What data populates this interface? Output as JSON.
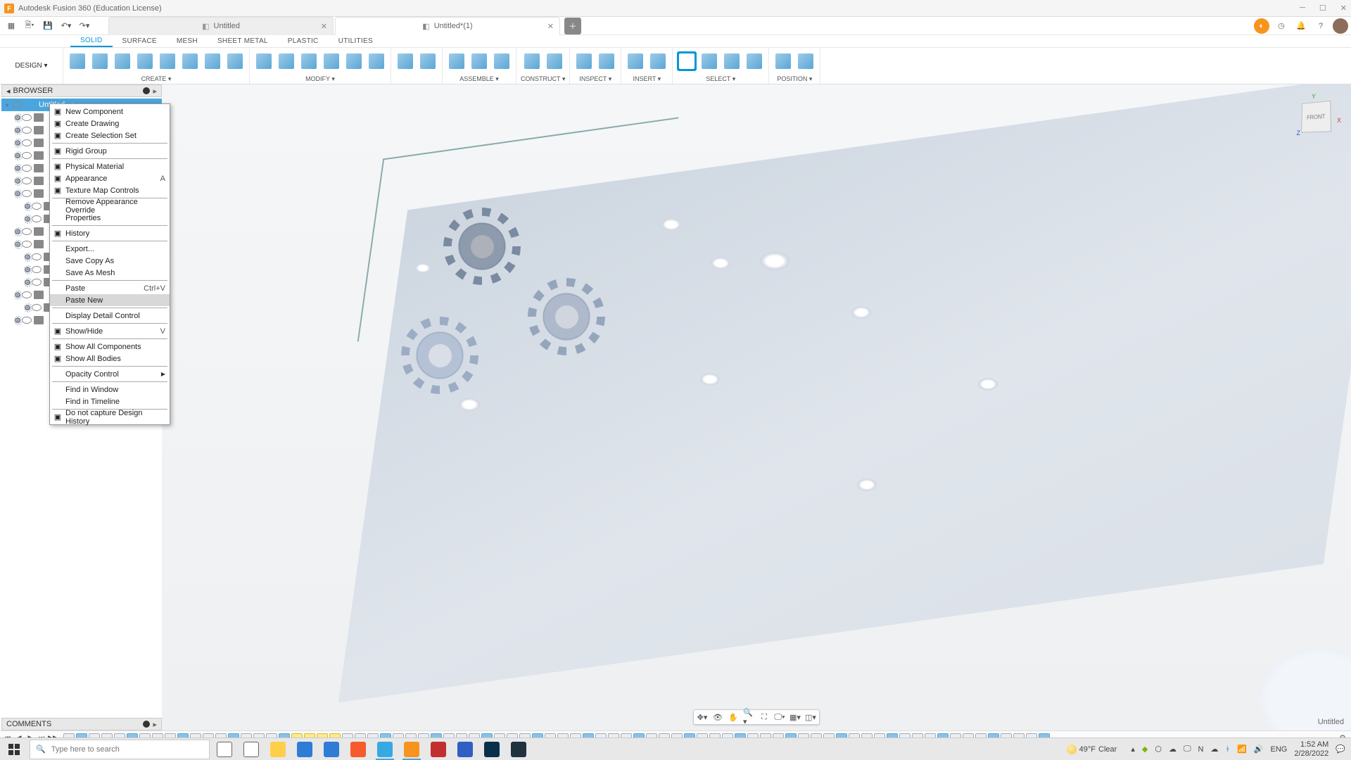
{
  "titlebar": {
    "app_badge": "F",
    "title": "Autodesk Fusion 360 (Education License)"
  },
  "tabs": [
    {
      "label": "Untitled",
      "active": false
    },
    {
      "label": "Untitled*(1)",
      "active": true
    }
  ],
  "ribbon": {
    "design_label": "DESIGN ▾",
    "tabs": [
      "SOLID",
      "SURFACE",
      "MESH",
      "SHEET METAL",
      "PLASTIC",
      "UTILITIES"
    ],
    "active_tab": "SOLID",
    "groups": [
      {
        "label": "CREATE ▾",
        "icons": 8
      },
      {
        "label": "MODIFY ▾",
        "icons": 6
      },
      {
        "label": "",
        "icons": 2
      },
      {
        "label": "ASSEMBLE ▾",
        "icons": 3
      },
      {
        "label": "CONSTRUCT ▾",
        "icons": 2
      },
      {
        "label": "INSPECT ▾",
        "icons": 2
      },
      {
        "label": "INSERT ▾",
        "icons": 2
      },
      {
        "label": "SELECT ▾",
        "icons": 4
      },
      {
        "label": "POSITION ▾",
        "icons": 2
      }
    ]
  },
  "browser": {
    "header": "BROWSER",
    "root": "Untitled",
    "rows": 18
  },
  "context_menu": {
    "items": [
      {
        "label": "New Component",
        "icon": "component-icon"
      },
      {
        "label": "Create Drawing",
        "icon": "drawing-icon"
      },
      {
        "label": "Create Selection Set",
        "icon": "selection-set-icon"
      },
      {
        "sep": true
      },
      {
        "label": "Rigid Group",
        "icon": "rigid-group-icon"
      },
      {
        "sep": true
      },
      {
        "label": "Physical Material",
        "icon": "material-icon"
      },
      {
        "label": "Appearance",
        "icon": "appearance-icon",
        "shortcut": "A"
      },
      {
        "label": "Texture Map Controls",
        "icon": "texture-icon"
      },
      {
        "sep": true
      },
      {
        "label": "Remove Appearance Override"
      },
      {
        "label": "Properties"
      },
      {
        "sep": true
      },
      {
        "label": "History",
        "icon": "history-icon"
      },
      {
        "sep": true
      },
      {
        "label": "Export..."
      },
      {
        "label": "Save Copy As"
      },
      {
        "label": "Save As Mesh"
      },
      {
        "sep": true
      },
      {
        "label": "Paste",
        "shortcut": "Ctrl+V"
      },
      {
        "label": "Paste New",
        "highlight": true
      },
      {
        "sep": true
      },
      {
        "label": "Display Detail Control"
      },
      {
        "sep": true
      },
      {
        "label": "Show/Hide",
        "icon": "eye-icon",
        "shortcut": "V"
      },
      {
        "sep": true
      },
      {
        "label": "Show All Components",
        "icon": "eye-icon"
      },
      {
        "label": "Show All Bodies",
        "icon": "eye-icon"
      },
      {
        "sep": true
      },
      {
        "label": "Opacity Control",
        "submenu": true
      },
      {
        "sep": true
      },
      {
        "label": "Find in Window"
      },
      {
        "label": "Find in Timeline"
      },
      {
        "sep": true
      },
      {
        "label": "Do not capture Design History",
        "icon": "capture-icon"
      }
    ]
  },
  "viewcube": {
    "face": "FRONT",
    "axes": {
      "x": "X",
      "y": "Y",
      "z": "Z"
    }
  },
  "viewport_label": "Untitled",
  "comments": {
    "header": "COMMENTS"
  },
  "timeline": {
    "controls": [
      "⏮",
      "◀",
      "▶",
      "⏭",
      "▶▶"
    ],
    "chips": 78,
    "yellow_range": [
      18,
      21
    ]
  },
  "taskbar": {
    "search_placeholder": "Type here to search",
    "weather": {
      "temp": "49°F",
      "cond": "Clear"
    },
    "lang": "ENG",
    "time": "1:52 AM",
    "date": "2/28/2022",
    "apps": [
      {
        "name": "cortana",
        "color": "#fff",
        "border": "#666"
      },
      {
        "name": "taskview",
        "color": "#fff",
        "border": "#666"
      },
      {
        "name": "explorer",
        "color": "#ffcf4a"
      },
      {
        "name": "store",
        "color": "#2e7cd6"
      },
      {
        "name": "mail",
        "color": "#2e7cd6"
      },
      {
        "name": "brave",
        "color": "#f55b2c"
      },
      {
        "name": "edge",
        "color": "#37a9e1",
        "active": true
      },
      {
        "name": "fusion",
        "color": "#f7941e",
        "active": true
      },
      {
        "name": "autocad",
        "color": "#c22f2f"
      },
      {
        "name": "revit",
        "color": "#2f5fc2"
      },
      {
        "name": "photoshop",
        "color": "#0a2f4a"
      },
      {
        "name": "steam",
        "color": "#21323f"
      }
    ]
  }
}
